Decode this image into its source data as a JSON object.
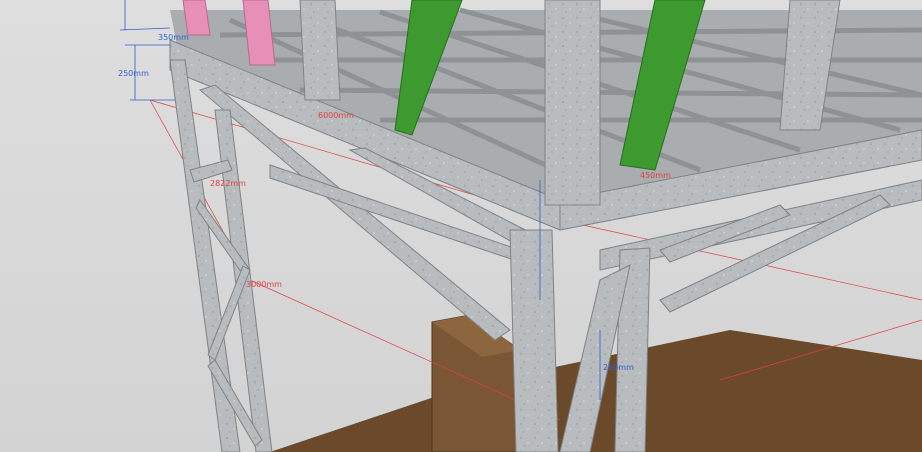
{
  "scene": {
    "colors": {
      "background": "#d9d9d9",
      "steel": "#b9bcbe",
      "steel_dark": "#8e9294",
      "steel_light": "#d4d6d7",
      "green_member": "#3d9a2f",
      "pink_member": "#e88fb8",
      "ground": "#6a4a2a",
      "block": "#7a5634",
      "dim_blue": "#2f5fd0",
      "dim_red": "#e04040"
    },
    "dimensions": [
      {
        "id": "dim-350",
        "label": "350mm",
        "color": "blue"
      },
      {
        "id": "dim-250-left",
        "label": "250mm",
        "color": "blue"
      },
      {
        "id": "dim-red-top",
        "label": "6000mm",
        "color": "red"
      },
      {
        "id": "dim-2822",
        "label": "2822mm",
        "color": "red"
      },
      {
        "id": "dim-3000",
        "label": "3000mm",
        "color": "red"
      },
      {
        "id": "dim-250-bottom",
        "label": "250mm",
        "color": "blue"
      },
      {
        "id": "dim-450",
        "label": "450mm",
        "color": "red"
      }
    ]
  }
}
